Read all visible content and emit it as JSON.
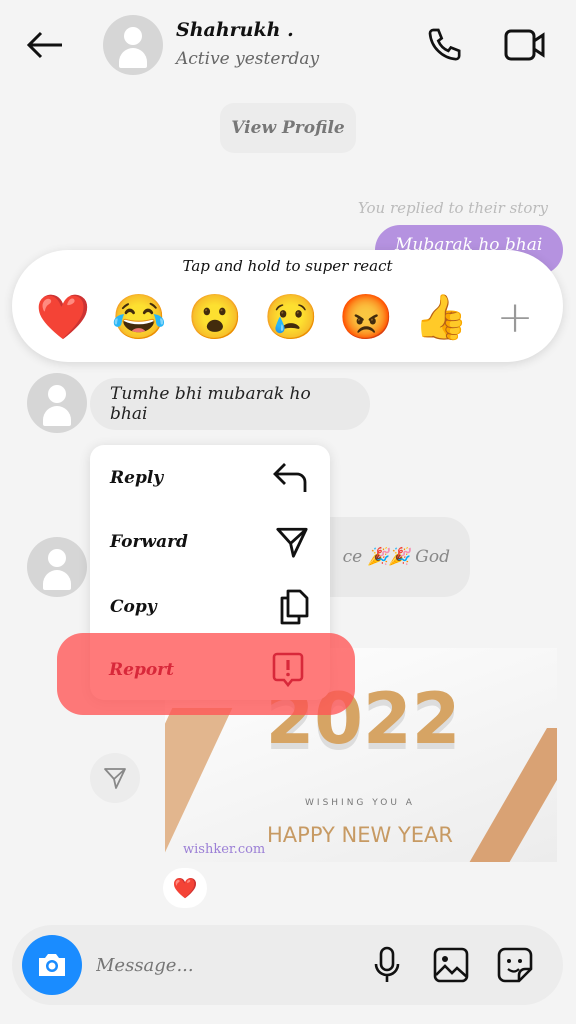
{
  "header": {
    "name": "Shahrukh .",
    "status": "Active yesterday"
  },
  "view_profile": "View Profile",
  "story_note": "You replied to their story",
  "sent_message": "Mubarak ho bhai",
  "reactions": {
    "hint": "Tap and hold to super react",
    "emojis": [
      "❤️",
      "😂",
      "😮",
      "😢",
      "😡",
      "👍"
    ],
    "more": "+"
  },
  "messages": {
    "first": "Tumhe bhi mubarak ho bhai",
    "second": "ce 🎉🎉 God"
  },
  "menu": {
    "items": [
      "Reply",
      "Forward",
      "Copy",
      "Report"
    ],
    "highlight_color": "#ff5a5a"
  },
  "image": {
    "year": "2022",
    "wishing": "WISHING YOU A",
    "greeting": "HAPPY NEW YEAR",
    "watermark": "wishker.com"
  },
  "reaction_badge": "❤️",
  "composer": {
    "placeholder": "Message...",
    "accent": "#1a8cff"
  }
}
